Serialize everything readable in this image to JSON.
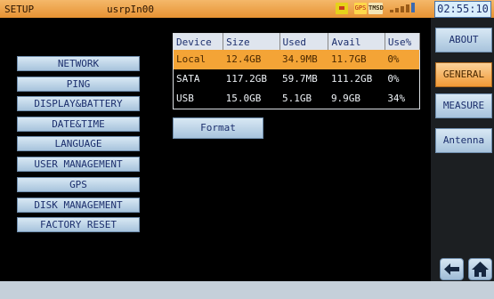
{
  "status_bar": {
    "title": "SETUP",
    "device_name": "usrpIn00",
    "gps_badge": "GPS",
    "mode_badge": "TMSD",
    "clock": "02:55:10",
    "icons": [
      "wifi-icon",
      "gps-icon",
      "mode-icon",
      "signal-icon"
    ]
  },
  "menu": {
    "items": [
      {
        "label": "NETWORK"
      },
      {
        "label": "PING"
      },
      {
        "label": "DISPLAY&BATTERY"
      },
      {
        "label": "DATE&TIME"
      },
      {
        "label": "LANGUAGE"
      },
      {
        "label": "USER MANAGEMENT"
      },
      {
        "label": "GPS"
      },
      {
        "label": "DISK MANAGEMENT"
      },
      {
        "label": "FACTORY RESET"
      }
    ]
  },
  "disk_table": {
    "headers": [
      "Device",
      "Size",
      "Used",
      "Avail",
      "Use%"
    ],
    "rows": [
      {
        "device": "Local",
        "size": "12.4GB",
        "used": "34.9MB",
        "avail": "11.7GB",
        "use_pct": "0%",
        "selected": true
      },
      {
        "device": "SATA",
        "size": "117.2GB",
        "used": "59.7MB",
        "avail": "111.2GB",
        "use_pct": "0%"
      },
      {
        "device": "USB",
        "size": "15.0GB",
        "used": "5.1GB",
        "avail": "9.9GB",
        "use_pct": "34%"
      }
    ]
  },
  "format_button": {
    "label": "Format"
  },
  "tabs": [
    {
      "label": "ABOUT"
    },
    {
      "label": "GENERAL",
      "active": true
    },
    {
      "label": "MEASURE"
    },
    {
      "label": "Antenna"
    }
  ],
  "nav": {
    "back_icon": "back-arrow-icon",
    "home_icon": "home-icon"
  },
  "colors": {
    "accent": "#f09936",
    "button": "#b9d0e4",
    "background": "#000000"
  }
}
